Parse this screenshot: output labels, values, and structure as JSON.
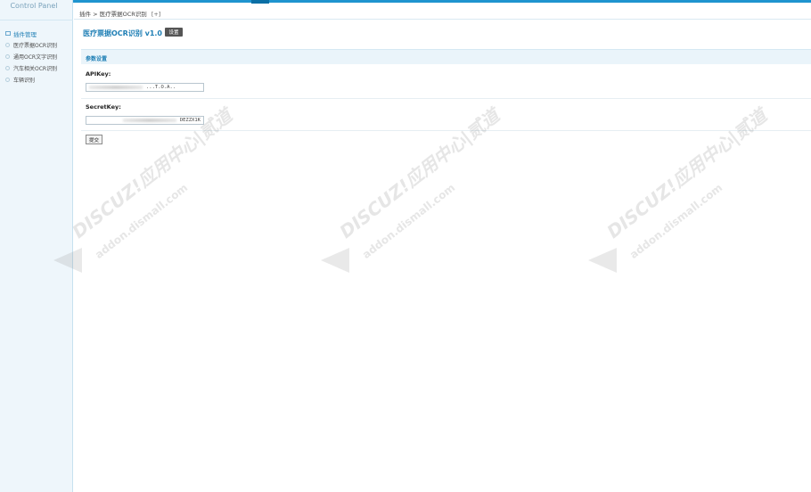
{
  "sidebar": {
    "title": "Control Panel",
    "group_label": "插件管理",
    "items": [
      {
        "label": "医疗票据OCR识别"
      },
      {
        "label": "通用OCR文字识别"
      },
      {
        "label": "汽车相关OCR识别"
      },
      {
        "label": "车辆识别"
      }
    ]
  },
  "breadcrumb": {
    "text": "插件 > 医疗票据OCR识别",
    "plus": "[+]"
  },
  "plugin": {
    "title": "医疗票据OCR识别 v1.0",
    "settings_label": "设置"
  },
  "section": {
    "title": "参数设置"
  },
  "form": {
    "apikey_label": "APIKey:",
    "apikey_value": "...T.O.A..",
    "secretkey_label": "SecretKey:",
    "secretkey_value": "DEZZX1K",
    "submit_label": "提交"
  },
  "watermark": {
    "line1": "DISCUZ!应用中心|贰道",
    "line2": "addon.dismall.com"
  },
  "colors": {
    "accent": "#1f94cf",
    "link": "#1f7fb5",
    "sidebar_bg": "#eef6fb"
  }
}
